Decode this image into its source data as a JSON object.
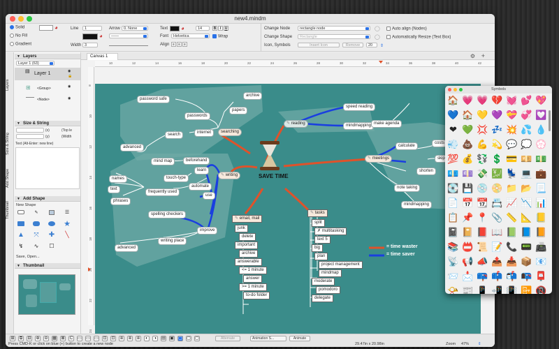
{
  "window": {
    "title": "new4.mindm"
  },
  "inspector": {
    "fill_solid": "Solid",
    "fill_none": "No Fill",
    "fill_gradient": "Gradient",
    "line_label": "Line",
    "line_value": "1",
    "arrow_label": "Arrow",
    "arrow_value": "0. None",
    "width_label": "Width",
    "width_value": "3",
    "text_label": "Text",
    "font_size": "14",
    "font_label": "Font",
    "font_value": "Helvetica",
    "wrap_label": "Wrap",
    "align_label": "Align",
    "bold": "B",
    "italic": "I",
    "underline": "U",
    "change_node_label": "Change Node",
    "change_node_value": "rectangle node",
    "change_shape_label": "Change Shape",
    "change_shape_value": "Rectangle",
    "icon_symbols_label": "Icon, Symbols",
    "insert_icon": "Insert Icon",
    "remove": "Remove",
    "icon_size": "20",
    "auto_align": "Auto align (Nodes)",
    "auto_resize": "Automatically Resize (Text Box)"
  },
  "sidebar": {
    "tabs": [
      "Layers",
      "Size & String",
      "Add Shape",
      "Thumbnail"
    ],
    "layers_title": "Layers",
    "layer_popup": "Layer 1 (63)",
    "layer_name": "Layer 1",
    "group_label": "<Group>",
    "node_label": "<Node>",
    "size_title": "Size & String",
    "pos_x": "(x)",
    "pos_y": "(y)",
    "top_left": "(Top le",
    "width": "(Width",
    "text_hint": "Text (Alt-Enter: new line)",
    "add_shape_title": "Add Shape",
    "new_shape": "New Shape",
    "save_open": "Save, Open...",
    "thumbnail_title": "Thumbnail"
  },
  "canvas": {
    "tab": "Canvas 1",
    "ruler_h": [
      "10",
      "12",
      "14",
      "16",
      "18",
      "20",
      "22",
      "24",
      "26",
      "28",
      "30",
      "32",
      "34",
      "36",
      "38",
      "40",
      "42"
    ],
    "ruler_v": [
      "8",
      "10",
      "12",
      "14",
      "16",
      "18",
      "20",
      "22",
      "24"
    ]
  },
  "mindmap": {
    "center": "SAVE TIME",
    "nodes": {
      "password_safe": "password safe",
      "archive": "archive",
      "passwords": "passwords",
      "papers": "papers",
      "internet": "internet",
      "searching": "searching",
      "search": "search",
      "advanced1": "advanced",
      "reading": "reading",
      "speed_reading": "speed reading",
      "mindmapping1": "mindmapping",
      "make_agenda": "make agenda",
      "calculate": "calculate",
      "costs": "costs",
      "meetings": "meetings",
      "skip": "skip",
      "shorten": "shorten",
      "note_taking": "note taking",
      "mindmapping2": "mindmapping",
      "mind_map": "mind map",
      "beforehand": "beforehand",
      "learn": "learn",
      "touch_type": "touch-type",
      "names": "names",
      "automate": "automate",
      "writing": "writing",
      "text": "text",
      "frequently_used": "frequently used",
      "use": "use",
      "phrases": "phrases",
      "spelling_checkers": "spelling checkers",
      "improve": "improve",
      "writing_place": "writing place",
      "advanced2": "advanced",
      "email": "email, mail",
      "junk": "junk",
      "delete": "delete",
      "important": "important",
      "archive2": "archive",
      "answerable": "answerable",
      "lt1": "<= 1 minute",
      "answer": "answer",
      "gt1": ">= 1 minute",
      "todo": "to-do folder",
      "tasks": "tasks",
      "split": "split",
      "multitasking": "multitasking",
      "text5": "text 5",
      "big": "big",
      "plan": "plan",
      "project_management": "project management",
      "mindmap": "mindmap",
      "moderate": "moderate",
      "pomodoro": "pomodoro",
      "delegate": "delegate"
    },
    "legend": {
      "waster": "= time waster",
      "saver": "= time saver",
      "waster_color": "#e0522a",
      "saver_color": "#1a3fe0"
    }
  },
  "statusbar": {
    "hint": "Press CMD-K or click on blue (+) button to create a new node",
    "dimensions": "29.47in x 20.98in",
    "zoom_label": "Zoom",
    "zoom_value": "47%",
    "animation": "Animation S...",
    "animate": "Animate",
    "alternate": "Alternate"
  },
  "symbols": {
    "title": "Symbols",
    "items": [
      "🏠",
      "💗",
      "💗",
      "💔",
      "💓",
      "💕",
      "💖",
      "💙",
      "🏠",
      "💛",
      "💜",
      "💝",
      "💞",
      "💟",
      "❤",
      "💚",
      "💢",
      "💤",
      "💥",
      "💦",
      "💧",
      "💨",
      "💩",
      "💪",
      "💫",
      "💬",
      "💭",
      "💮",
      "💯",
      "💰",
      "💱",
      "💲",
      "💳",
      "💴",
      "💵",
      "💶",
      "💷",
      "💸",
      "💹",
      "💺",
      "💻",
      "💼",
      "💽",
      "💾",
      "💿",
      "📀",
      "📁",
      "📂",
      "📃",
      "📄",
      "📅",
      "📆",
      "📇",
      "📈",
      "📉",
      "📊",
      "📋",
      "📌",
      "📍",
      "📎",
      "📏",
      "📐",
      "📒",
      "📓",
      "📔",
      "📕",
      "📖",
      "📗",
      "📘",
      "📙",
      "📚",
      "📛",
      "📜",
      "📝",
      "📞",
      "📟",
      "📠",
      "📡",
      "📢",
      "📣",
      "📤",
      "📥",
      "📦",
      "📧",
      "📨",
      "📩",
      "📪",
      "📫",
      "📬",
      "📭",
      "📮",
      "📯",
      "📰",
      "📱",
      "📲",
      "📳",
      "📴",
      "📵",
      "📶",
      "📷",
      "📹",
      "📺",
      "📻",
      "📼"
    ]
  }
}
